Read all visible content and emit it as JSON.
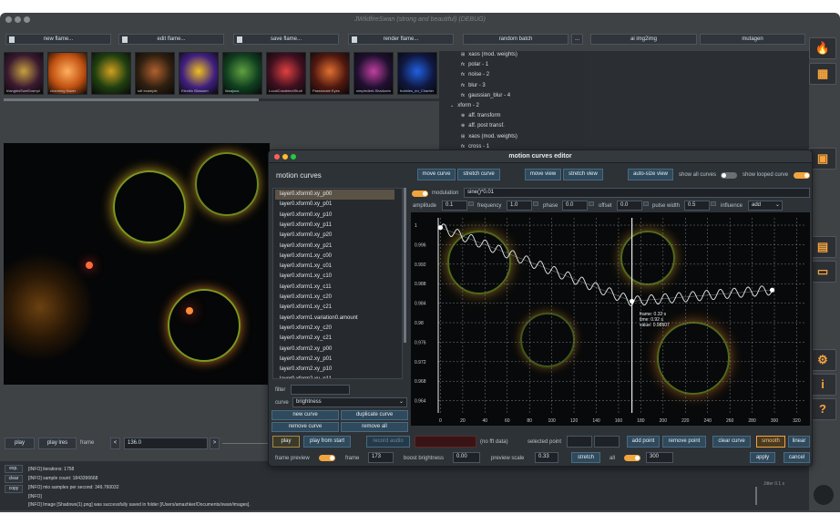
{
  "window": {
    "title": "JWildfireSwan (strong and beautiful) (DEBUG)"
  },
  "toolbar": {
    "new_flame": "new flame...",
    "edit_flame": "edit flame...",
    "save_flame": "save flame...",
    "render_flame": "render flame...",
    "random_batch": "random batch",
    "more": "...",
    "ai_img2img": "ai img2img",
    "mutagen": "mutagen"
  },
  "thumbnails": [
    {
      "label": "trianglesSumExampl"
    },
    {
      "label": "charming flower"
    },
    {
      "label": ""
    },
    {
      "label": "sdf example"
    },
    {
      "label": "Electric Blossom"
    },
    {
      "label": "lissajous"
    },
    {
      "label": "LocalCosdetectStudi"
    },
    {
      "label": "Passionate Eyes"
    },
    {
      "label": "simpledeeLShadowing..."
    },
    {
      "label": "bubbles_en_Chanter"
    }
  ],
  "tree": {
    "items": [
      {
        "label": "xaos (mod. weights)",
        "icon": "xaos-icon"
      },
      {
        "label": "polar - 1",
        "icon": "fx-icon"
      },
      {
        "label": "noise - 2",
        "icon": "fx-icon"
      },
      {
        "label": "blur - 3",
        "icon": "fx-icon"
      },
      {
        "label": "gaussian_blur - 4",
        "icon": "fx-icon"
      },
      {
        "label": "xform - 2",
        "icon": "expand-icon"
      },
      {
        "label": "aff. transform",
        "icon": "transform-icon"
      },
      {
        "label": "aff. post transf.",
        "icon": "transform-icon"
      },
      {
        "label": "xaos (mod. weights)",
        "icon": "xaos-icon"
      },
      {
        "label": "cross - 1",
        "icon": "fx-icon"
      }
    ]
  },
  "player": {
    "play": "play",
    "play_lres": "play lres",
    "frame_label": "frame",
    "frame_value": "136.0",
    "prev": "<",
    "next": ">"
  },
  "log": {
    "buttons": {
      "exp": "exp.",
      "clear": "clear",
      "copy": "copy"
    },
    "lines": [
      "[INFO]   iterations: 1758",
      "[INFO]   sample count: 1843396668",
      "[INFO]   mio samples per second: 349.760032",
      "[INFO]",
      "[INFO]   Image [Shadows(1).png] was successfully saved in folder [/Users/amaxhker/Documents/swan/images]."
    ],
    "side_text": "Jitter 0.1 s"
  },
  "editor": {
    "title": "motion curves editor",
    "heading": "motion curves",
    "buttons": {
      "move_curve": "move curve",
      "stretch_curve": "stretch curve",
      "move_view": "move view",
      "stretch_view": "stretch view",
      "auto_size_view": "auto-size view"
    },
    "show_all_curves": "show all curves",
    "show_looped_curve": "show looped curve",
    "curves": [
      "layer0.xform0.xy_p00",
      "layer0.xform0.xy_p01",
      "layer0.xform0.xy_p10",
      "layer0.xform0.xy_p11",
      "layer0.xform0.xy_p20",
      "layer0.xform0.xy_p21",
      "layer0.xform1.xy_c00",
      "layer0.xform1.xy_c01",
      "layer0.xform1.xy_c10",
      "layer0.xform1.xy_c11",
      "layer0.xform1.xy_c20",
      "layer0.xform1.xy_c21",
      "layer0.xform1.variation0.amount",
      "layer0.xform2.xy_c20",
      "layer0.xform2.xy_c21",
      "layer0.xform2.xy_p00",
      "layer0.xform2.xy_p01",
      "layer0.xform2.xy_p10",
      "layer0.xform2.xy_p11"
    ],
    "filter_label": "filter",
    "filter_value": "",
    "curve_label": "curve",
    "curve_value": "brightness",
    "new_curve": "new curve",
    "duplicate_curve": "duplicate curve",
    "remove_curve": "remove curve",
    "remove_all": "remove all",
    "modulation_label": "modulation",
    "modulation_value": "sine()*0.01",
    "amplitude_label": "amplitude",
    "amplitude_value": "0.1",
    "frequency_label": "frequency",
    "frequency_value": "1.0",
    "phase_label": "phase",
    "phase_value": "0.0",
    "offset_label": "offset",
    "offset_value": "0.0",
    "pulse_width_label": "pulse width",
    "pulse_width_value": "0.5",
    "influence_label": "influence",
    "influence_value": "add",
    "tooltip": {
      "line1": "frame: 0.32 s",
      "line2": "time: 0.92 s",
      "line3": "value: 0.98507"
    },
    "play": "play",
    "play_from_start": "play from start",
    "record_audio": "record audio",
    "no_fft": "(no fft data)",
    "selected_point": "selected point",
    "add_point": "add point",
    "remove_point": "remove point",
    "clear_curve": "clear curve",
    "smooth": "smooth",
    "linear": "linear",
    "frame_preview": "frame preview",
    "frame_label": "frame",
    "frame_value": "173",
    "boost_label": "boost brightness",
    "boost_value": "0.00",
    "preview_scale_label": "preview scale",
    "preview_scale_value": "0.33",
    "stretch": "stretch",
    "all": "all",
    "all_value": "300",
    "apply": "apply",
    "cancel": "cancel"
  },
  "chart_data": {
    "type": "line",
    "title": "",
    "xlabel": "",
    "ylabel": "",
    "x_ticks": [
      0,
      20,
      40,
      60,
      80,
      100,
      120,
      140,
      160,
      180,
      200,
      220,
      240,
      260,
      280,
      300,
      320
    ],
    "y_ticks": [
      0.964,
      0.968,
      0.972,
      0.976,
      0.98,
      0.984,
      0.988,
      0.992,
      0.996,
      1.0
    ],
    "xlim": [
      -2,
      327
    ],
    "ylim": [
      0.9615,
      1.0015
    ],
    "cursor_frame": 172,
    "series": [
      {
        "x": [
          0,
          172,
          298
        ],
        "y": [
          0.9995,
          0.9844,
          0.9867
        ]
      }
    ],
    "modulation": {
      "amplitude": 0.001,
      "frequency": 1.0,
      "cycles": 24
    },
    "grid": true
  },
  "colors": {
    "accent": "#f2a43d",
    "panel": "#2d3237",
    "button": "#2f4a5d"
  }
}
